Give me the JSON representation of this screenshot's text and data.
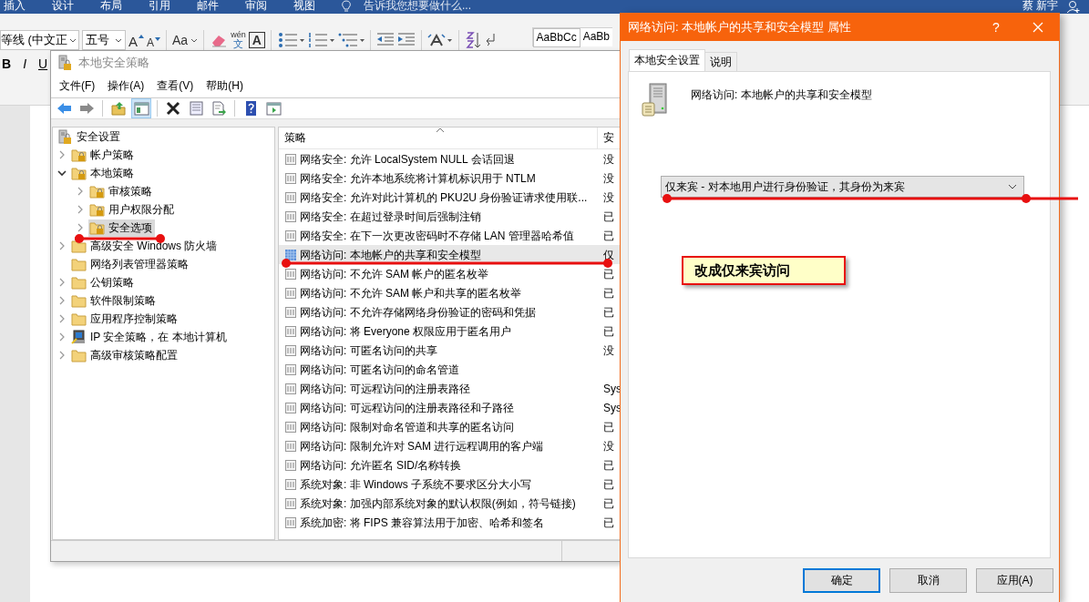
{
  "word": {
    "tabs": [
      "插入",
      "设计",
      "布局",
      "引用",
      "邮件",
      "审阅",
      "视图"
    ],
    "tell_me": "告诉我您想要做什么...",
    "user": "蔡 新宇",
    "font_name": "等线 (中文正",
    "font_size": "五号",
    "groups": [
      [
        {
          "kind": "grow",
          "label": "A"
        },
        {
          "kind": "shrink",
          "label": "A"
        }
      ],
      [
        {
          "kind": "case",
          "label": "Aa"
        }
      ],
      [
        {
          "kind": "clear"
        },
        {
          "kind": "phonetic",
          "label": "wén",
          "sub": "文"
        },
        {
          "kind": "border",
          "label": "A"
        }
      ],
      [
        {
          "kind": "bullets"
        },
        {
          "kind": "numbering"
        },
        {
          "kind": "multilevel"
        }
      ],
      [
        {
          "kind": "outdent"
        },
        {
          "kind": "indent"
        }
      ],
      [
        {
          "kind": "textdir"
        }
      ],
      [
        {
          "kind": "sort"
        },
        {
          "kind": "mark"
        }
      ]
    ],
    "styles": [
      "AaBbCc",
      "AaBb"
    ],
    "format": [
      "B",
      "I",
      "U"
    ]
  },
  "mmc": {
    "title": "本地安全策略",
    "menu": [
      "文件(F)",
      "操作(A)",
      "查看(V)",
      "帮助(H)"
    ],
    "toolbar": [
      [
        {
          "kind": "back",
          "pressed": false
        },
        {
          "kind": "forward",
          "pressed": false
        }
      ],
      [
        {
          "kind": "up",
          "pressed": false
        },
        {
          "kind": "tree",
          "pressed": true
        }
      ],
      [
        {
          "kind": "delete",
          "pressed": false
        },
        {
          "kind": "properties",
          "pressed": false
        },
        {
          "kind": "export",
          "pressed": false
        }
      ],
      [
        {
          "kind": "help",
          "pressed": false
        },
        {
          "kind": "console",
          "pressed": false
        }
      ]
    ],
    "tree": [
      {
        "label": "安全设置",
        "kind": "server",
        "expandable": false,
        "selected": false,
        "children": [
          {
            "label": "帐户策略",
            "kind": "locked-folder",
            "expandable": true,
            "expanded": false,
            "selected": false
          },
          {
            "label": "本地策略",
            "kind": "locked-folder",
            "expandable": true,
            "expanded": true,
            "selected": false,
            "children": [
              {
                "label": "审核策略",
                "kind": "locked-folder",
                "expandable": true,
                "expanded": false,
                "selected": false
              },
              {
                "label": "用户权限分配",
                "kind": "locked-folder",
                "expandable": true,
                "expanded": false,
                "selected": false
              },
              {
                "label": "安全选项",
                "kind": "locked-folder",
                "expandable": true,
                "expanded": false,
                "selected": true
              }
            ]
          },
          {
            "label": "高级安全 Windows 防火墙",
            "kind": "folder",
            "expandable": true,
            "expanded": false,
            "selected": false
          },
          {
            "label": "网络列表管理器策略",
            "kind": "folder",
            "expandable": false,
            "selected": false
          },
          {
            "label": "公钥策略",
            "kind": "folder",
            "expandable": true,
            "expanded": false,
            "selected": false
          },
          {
            "label": "软件限制策略",
            "kind": "folder",
            "expandable": true,
            "expanded": false,
            "selected": false
          },
          {
            "label": "应用程序控制策略",
            "kind": "folder",
            "expandable": true,
            "expanded": false,
            "selected": false
          },
          {
            "label": "IP 安全策略，在 本地计算机",
            "kind": "network",
            "expandable": true,
            "expanded": false,
            "selected": false
          },
          {
            "label": "高级审核策略配置",
            "kind": "folder",
            "expandable": true,
            "expanded": false,
            "selected": false
          }
        ]
      }
    ],
    "list": {
      "columns": [
        "策略",
        "安"
      ],
      "rows": [
        {
          "policy": "网络安全: 允许 LocalSystem NULL 会话回退",
          "setting": "没",
          "selected": false
        },
        {
          "policy": "网络安全: 允许本地系统将计算机标识用于 NTLM",
          "setting": "没",
          "selected": false
        },
        {
          "policy": "网络安全: 允许对此计算机的 PKU2U 身份验证请求使用联...",
          "setting": "没",
          "selected": false
        },
        {
          "policy": "网络安全: 在超过登录时间后强制注销",
          "setting": "已",
          "selected": false
        },
        {
          "policy": "网络安全: 在下一次更改密码时不存储 LAN 管理器哈希值",
          "setting": "已",
          "selected": false
        },
        {
          "policy": "网络访问: 本地帐户的共享和安全模型",
          "setting": "仅",
          "selected": true
        },
        {
          "policy": "网络访问: 不允许 SAM 帐户的匿名枚举",
          "setting": "已",
          "selected": false
        },
        {
          "policy": "网络访问: 不允许 SAM 帐户和共享的匿名枚举",
          "setting": "已",
          "selected": false
        },
        {
          "policy": "网络访问: 不允许存储网络身份验证的密码和凭据",
          "setting": "已",
          "selected": false
        },
        {
          "policy": "网络访问: 将 Everyone 权限应用于匿名用户",
          "setting": "已",
          "selected": false
        },
        {
          "policy": "网络访问: 可匿名访问的共享",
          "setting": "没",
          "selected": false
        },
        {
          "policy": "网络访问: 可匿名访问的命名管道",
          "selected": false
        },
        {
          "policy": "网络访问: 可远程访问的注册表路径",
          "setting": "Sys",
          "selected": false
        },
        {
          "policy": "网络访问: 可远程访问的注册表路径和子路径",
          "setting": "Sys",
          "selected": false
        },
        {
          "policy": "网络访问: 限制对命名管道和共享的匿名访问",
          "setting": "已",
          "selected": false
        },
        {
          "policy": "网络访问: 限制允许对 SAM 进行远程调用的客户端",
          "setting": "没",
          "selected": false
        },
        {
          "policy": "网络访问: 允许匿名 SID/名称转换",
          "setting": "已",
          "selected": false
        },
        {
          "policy": "系统对象: 非 Windows 子系统不要求区分大小写",
          "setting": "已",
          "selected": false
        },
        {
          "policy": "系统对象: 加强内部系统对象的默认权限(例如，符号链接)",
          "setting": "已",
          "selected": false
        },
        {
          "policy": "系统加密: 将 FIPS 兼容算法用于加密、哈希和签名",
          "setting": "已",
          "selected": false
        }
      ]
    }
  },
  "dialog": {
    "title": "网络访问: 本地帐户的共享和安全模型 属性",
    "help": "?",
    "tabs": [
      {
        "label": "本地安全设置",
        "selected": true
      },
      {
        "label": "说明",
        "selected": false
      }
    ],
    "heading": "网络访问: 本地帐户的共享和安全模型",
    "value": "仅来宾 - 对本地用户进行身份验证，其身份为来宾",
    "note": "改成仅来宾访问",
    "buttons": [
      {
        "label": "确定",
        "default": true
      },
      {
        "label": "取消",
        "default": false
      },
      {
        "label": "应用(A)",
        "default": false
      }
    ]
  }
}
